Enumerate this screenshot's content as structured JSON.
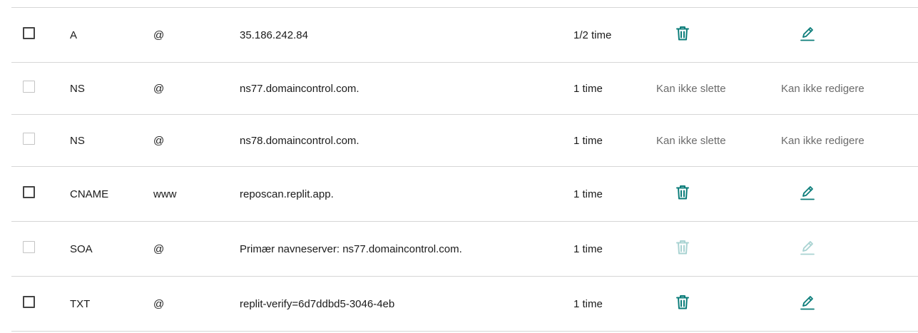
{
  "colors": {
    "accent": "#0c7d7a",
    "accent_disabled": "#a9d3d2",
    "divider": "#d6d6d6",
    "muted_text": "#6b6b6b"
  },
  "records": [
    {
      "type": "A",
      "name": "@",
      "data": "35.186.242.84",
      "ttl": "1/2 time",
      "checkbox_enabled": true,
      "delete": {
        "mode": "icon",
        "icon": "trash-icon"
      },
      "edit": {
        "mode": "icon",
        "icon": "pencil-icon"
      }
    },
    {
      "type": "NS",
      "name": "@",
      "data": "ns77.domaincontrol.com.",
      "ttl": "1 time",
      "checkbox_enabled": false,
      "delete": {
        "mode": "text",
        "text": "Kan ikke slette"
      },
      "edit": {
        "mode": "text",
        "text": "Kan ikke redigere"
      }
    },
    {
      "type": "NS",
      "name": "@",
      "data": "ns78.domaincontrol.com.",
      "ttl": "1 time",
      "checkbox_enabled": false,
      "delete": {
        "mode": "text",
        "text": "Kan ikke slette"
      },
      "edit": {
        "mode": "text",
        "text": "Kan ikke redigere"
      }
    },
    {
      "type": "CNAME",
      "name": "www",
      "data": "reposcan.replit.app.",
      "ttl": "1 time",
      "checkbox_enabled": true,
      "delete": {
        "mode": "icon",
        "icon": "trash-icon"
      },
      "edit": {
        "mode": "icon",
        "icon": "pencil-icon"
      }
    },
    {
      "type": "SOA",
      "name": "@",
      "data": "Primær navneserver: ns77.domaincontrol.com.",
      "ttl": "1 time",
      "checkbox_enabled": false,
      "delete": {
        "mode": "icon-disabled",
        "icon": "trash-icon"
      },
      "edit": {
        "mode": "icon-disabled",
        "icon": "pencil-icon"
      }
    },
    {
      "type": "TXT",
      "name": "@",
      "data": "replit-verify=6d7ddbd5-3046-4eb",
      "ttl": "1 time",
      "checkbox_enabled": true,
      "delete": {
        "mode": "icon",
        "icon": "trash-icon"
      },
      "edit": {
        "mode": "icon",
        "icon": "pencil-icon"
      }
    }
  ]
}
